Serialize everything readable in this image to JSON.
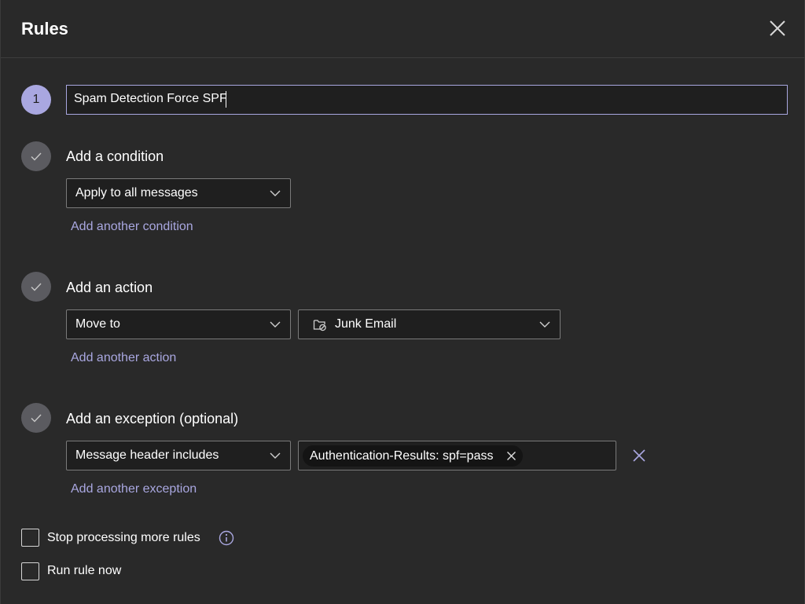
{
  "dialog": {
    "title": "Rules",
    "close_icon": "close-icon"
  },
  "step1": {
    "number": "1",
    "rule_name": "Spam Detection Force SPF"
  },
  "condition": {
    "title": "Add a condition",
    "selected": "Apply to all messages",
    "add_link": "Add another condition"
  },
  "action": {
    "title": "Add an action",
    "selected": "Move to",
    "folder": "Junk Email",
    "folder_icon": "junk-folder-icon",
    "add_link": "Add another action"
  },
  "exception": {
    "title": "Add an exception (optional)",
    "selected": "Message header includes",
    "tag": "Authentication-Results: spf=pass",
    "add_link": "Add another exception"
  },
  "options": {
    "stop_processing": "Stop processing more rules",
    "stop_processing_checked": false,
    "run_now": "Run rule now",
    "run_now_checked": false
  },
  "colors": {
    "background": "#292929",
    "accent": "#a9a7e0",
    "input_bg": "#1f1f1f",
    "check_circle": "#5b5b60"
  }
}
